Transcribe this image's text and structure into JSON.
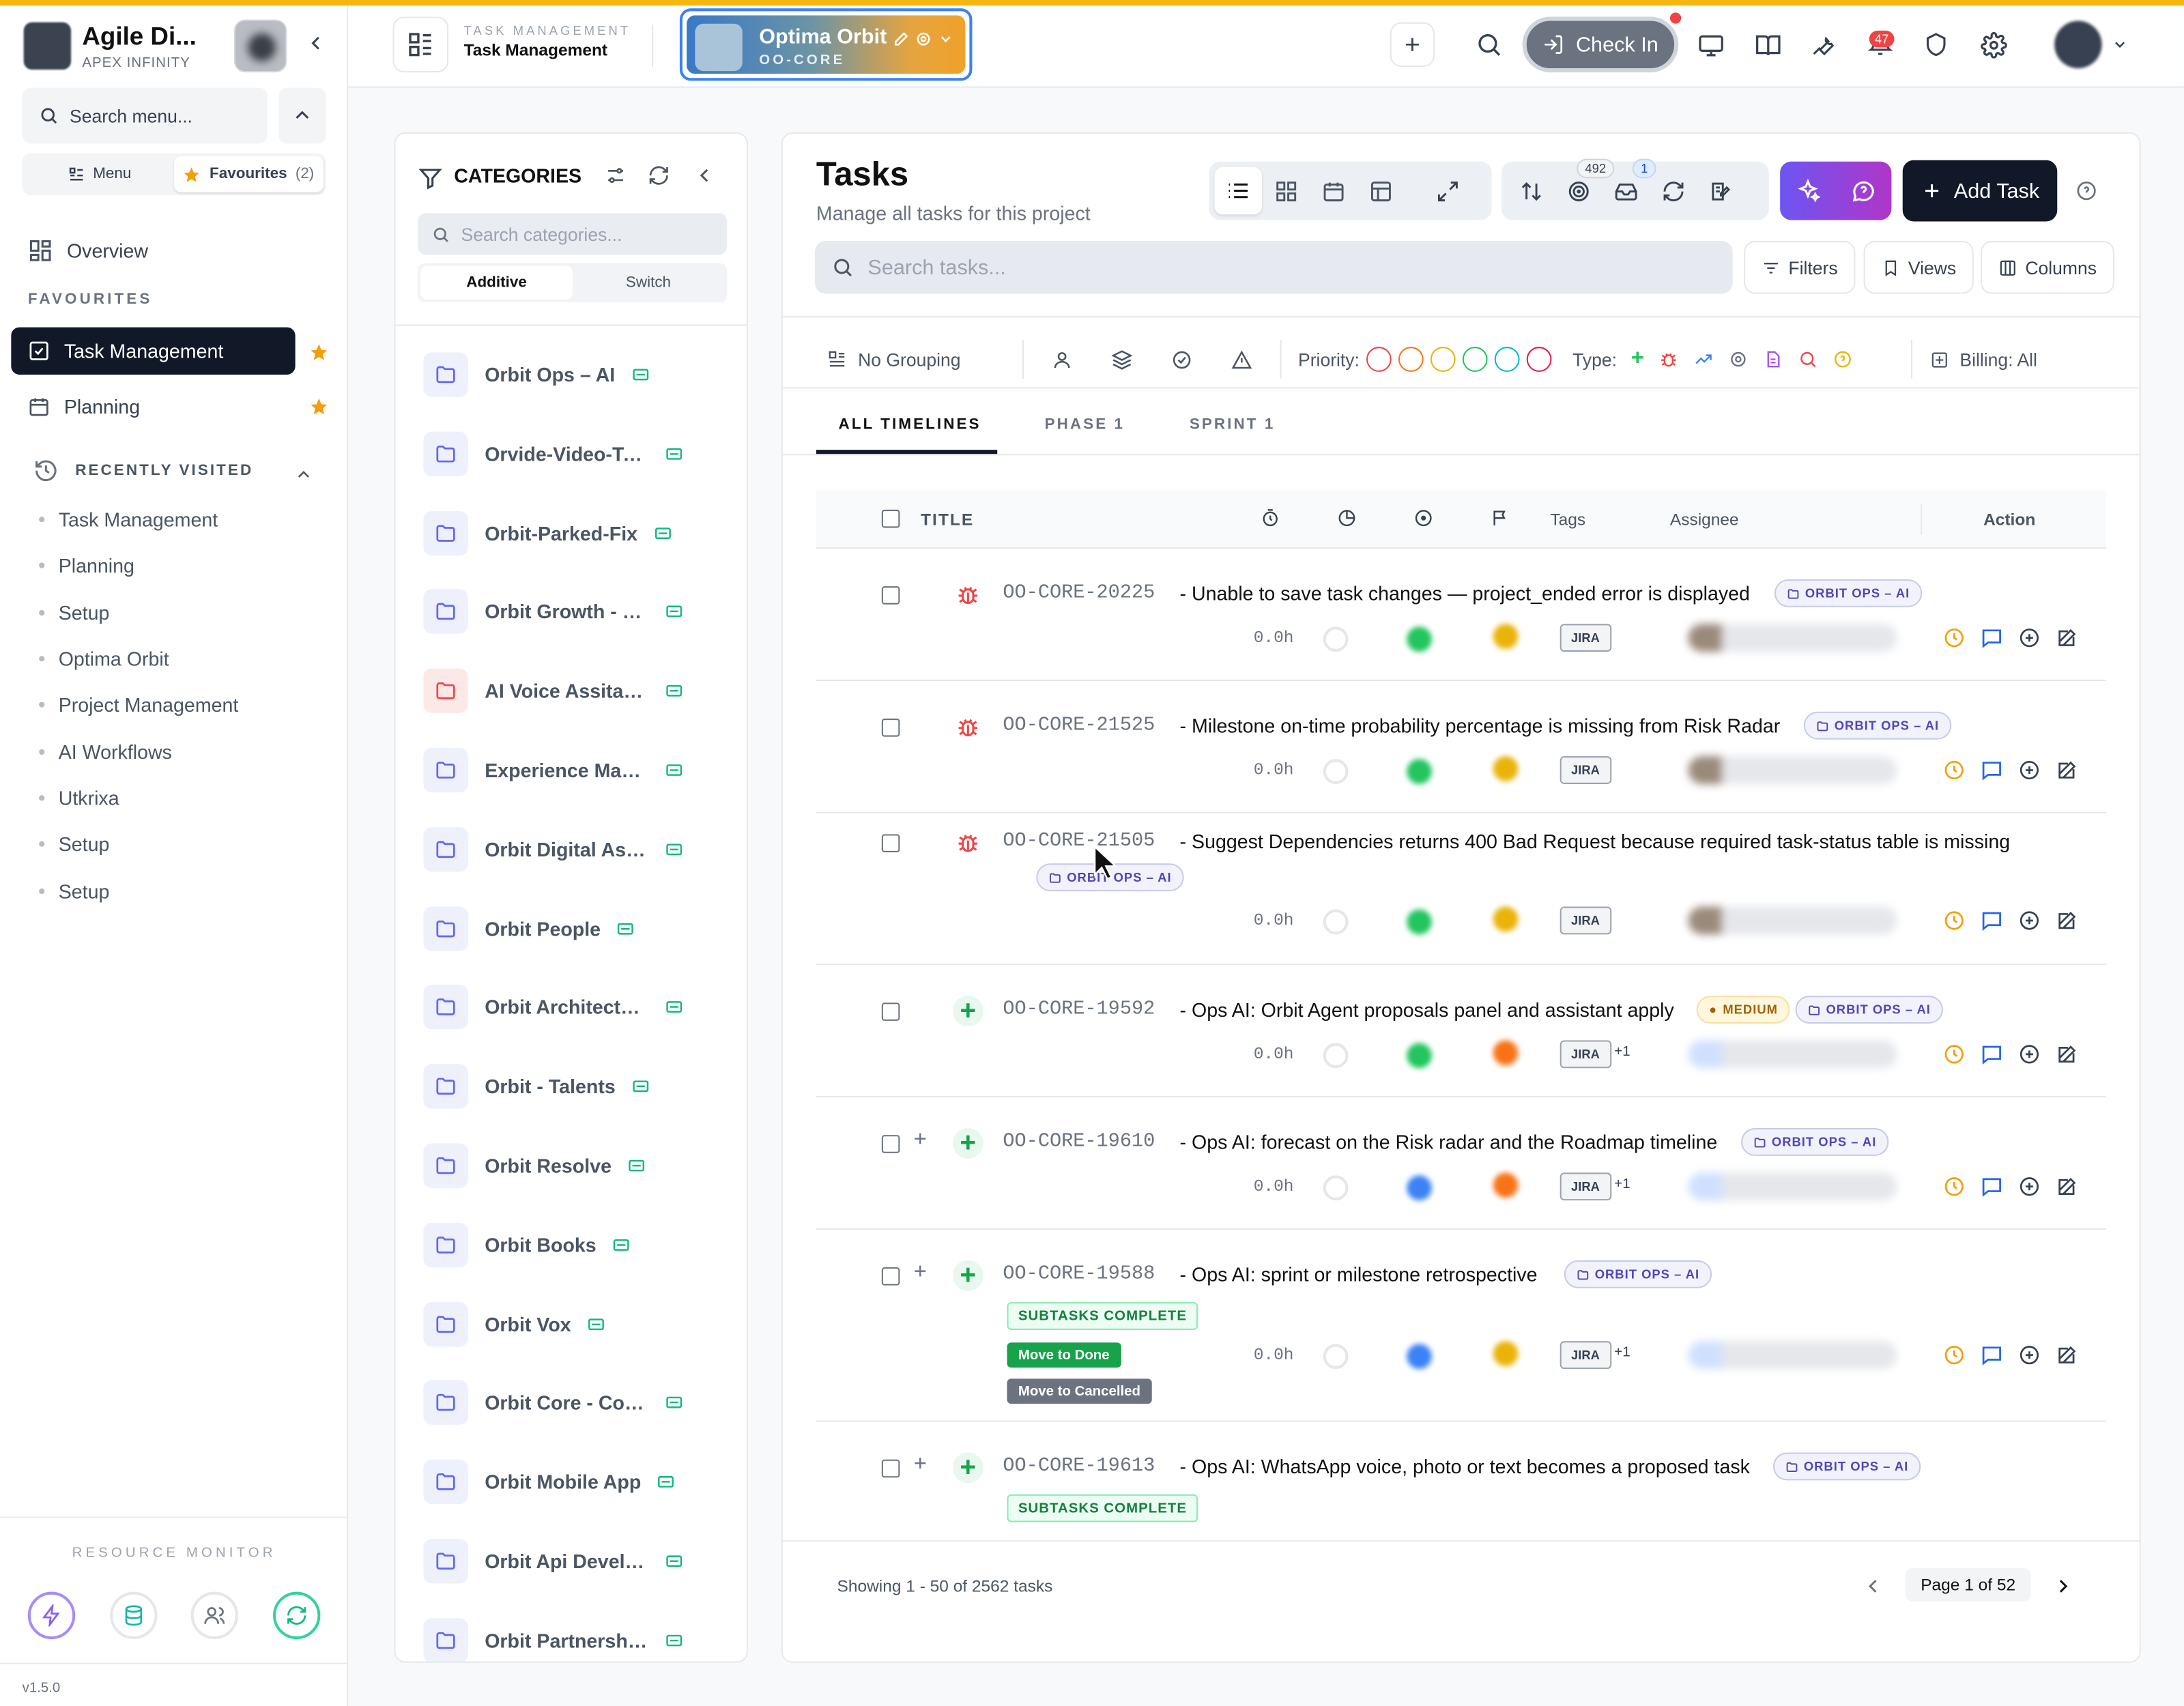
{
  "sidebar": {
    "brand": "Agile Di...",
    "brand_sub": "APEX INFINITY",
    "search_placeholder": "Search menu...",
    "tab_menu": "Menu",
    "tab_favourites": "Favourites",
    "favourites_count": "(2)",
    "overview": "Overview",
    "favourites_heading": "FAVOURITES",
    "favourites": [
      {
        "label": "Task Management",
        "active": true
      },
      {
        "label": "Planning",
        "active": false
      }
    ],
    "recent_heading": "RECENTLY VISITED",
    "recent": [
      "Task Management",
      "Planning",
      "Setup",
      "Optima Orbit",
      "Project Management",
      "AI Workflows",
      "Utkrixa",
      "Setup",
      "Setup"
    ],
    "resource_monitor": "RESOURCE MONITOR",
    "version": "v1.5.0"
  },
  "header": {
    "small": "TASK MANAGEMENT",
    "title": "Task Management",
    "project_name": "Optima Orbit",
    "project_code": "OO-CORE",
    "checkin": "Check In",
    "notifications": "47"
  },
  "categories": {
    "title": "CATEGORIES",
    "search_placeholder": "Search categories...",
    "mode_additive": "Additive",
    "mode_switch": "Switch",
    "items": [
      {
        "label": "Orbit Ops – AI",
        "red": false
      },
      {
        "label": "Orvide-Video-Tut...",
        "red": false
      },
      {
        "label": "Orbit-Parked-Fix",
        "red": false
      },
      {
        "label": "Orbit Growth - M...",
        "red": false
      },
      {
        "label": "AI Voice Assitan...",
        "red": true
      },
      {
        "label": "Experience Man...",
        "red": false
      },
      {
        "label": "Orbit Digital Ass...",
        "red": false
      },
      {
        "label": "Orbit People",
        "red": false
      },
      {
        "label": "Orbit Architectur...",
        "red": false
      },
      {
        "label": "Orbit - Talents",
        "red": false
      },
      {
        "label": "Orbit Resolve",
        "red": false
      },
      {
        "label": "Orbit Books",
        "red": false
      },
      {
        "label": "Orbit Vox",
        "red": false
      },
      {
        "label": "Orbit Core - Com...",
        "red": false
      },
      {
        "label": "Orbit Mobile App",
        "red": false
      },
      {
        "label": "Orbit Api Develo...",
        "red": false
      },
      {
        "label": "Orbit Partnerships",
        "red": false
      }
    ]
  },
  "tasks": {
    "title": "Tasks",
    "subtitle": "Manage all tasks for this project",
    "badge_492": "492",
    "badge_1": "1",
    "add_task": "Add Task",
    "search_placeholder": "Search tasks...",
    "filters": "Filters",
    "views": "Views",
    "columns": "Columns",
    "grouping": "No Grouping",
    "priority_label": "Priority:",
    "priority_colors": [
      "#ef4444",
      "#f97316",
      "#eab308",
      "#22c55e",
      "#06b6d4",
      "#e11d48"
    ],
    "type_label": "Type:",
    "billing": "Billing: All",
    "tabs": [
      "ALL TIMELINES",
      "PHASE 1",
      "SPRINT 1"
    ],
    "col_title": "TITLE",
    "col_tags": "Tags",
    "col_assignee": "Assignee",
    "col_action": "Action",
    "rows": [
      {
        "key": "OO-CORE-20225",
        "name": "- Unable to save task changes — project_ended error is displayed",
        "tag": "ORBIT OPS – AI",
        "type": "bug",
        "hours": "0.0h",
        "jira": "JIRA"
      },
      {
        "key": "OO-CORE-21525",
        "name": "- Milestone on-time probability percentage is missing from Risk Radar",
        "tag": "ORBIT OPS – AI",
        "type": "bug",
        "hours": "0.0h",
        "jira": "JIRA"
      },
      {
        "key": "OO-CORE-21505",
        "name": "- Suggest Dependencies returns 400 Bad Request because required task-status table is missing",
        "tag": "ORBIT OPS – AI",
        "type": "bug",
        "hours": "0.0h",
        "jira": "JIRA"
      },
      {
        "key": "OO-CORE-19592",
        "name": "- Ops AI: Orbit Agent proposals panel and assistant apply",
        "priority": "MEDIUM",
        "tag": "ORBIT OPS – AI",
        "type": "feature",
        "hours": "0.0h",
        "jira": "JIRA",
        "extra": "+1"
      },
      {
        "key": "OO-CORE-19610",
        "name": "- Ops AI: forecast on the Risk radar and the Roadmap timeline",
        "tag": "ORBIT OPS – AI",
        "type": "feature",
        "hours": "0.0h",
        "jira": "JIRA",
        "extra": "+1"
      },
      {
        "key": "OO-CORE-19588",
        "name": "- Ops AI: sprint or milestone retrospective",
        "tag": "ORBIT OPS – AI",
        "type": "feature",
        "hours": "0.0h",
        "jira": "JIRA",
        "extra": "+1",
        "subtasks": "SUBTASKS COMPLETE",
        "move_done": "Move to Done",
        "move_cancelled": "Move to Cancelled"
      },
      {
        "key": "OO-CORE-19613",
        "name": "- Ops AI: WhatsApp voice, photo or text becomes a proposed task",
        "tag": "ORBIT OPS – AI",
        "type": "feature",
        "subtasks": "SUBTASKS COMPLETE"
      }
    ],
    "showing": "Showing 1 - 50 of 2562 tasks",
    "page": "Page 1 of 52"
  }
}
